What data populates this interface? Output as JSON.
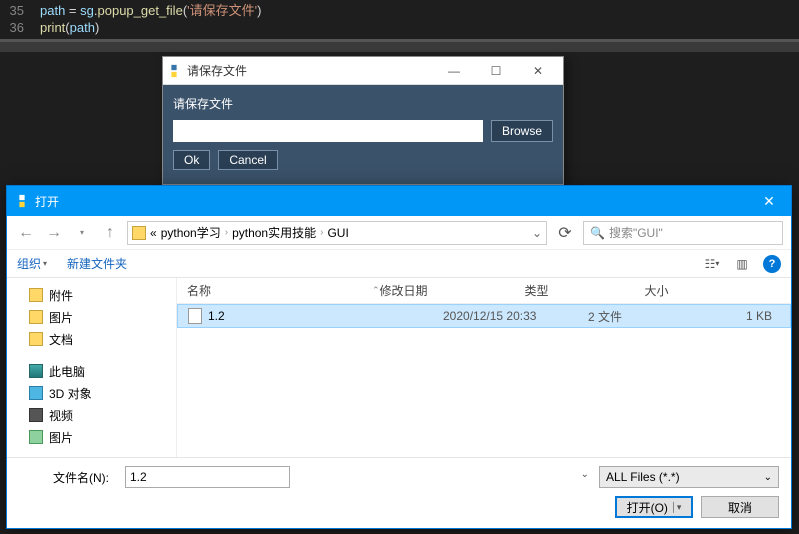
{
  "code": {
    "lines": [
      {
        "num": "35",
        "tokens": [
          {
            "t": "path",
            "c": "v"
          },
          {
            "t": " = ",
            "c": "op"
          },
          {
            "t": "sg",
            "c": "v"
          },
          {
            "t": ".",
            "c": "op"
          },
          {
            "t": "popup_get_file",
            "c": "fn"
          },
          {
            "t": "(",
            "c": "op"
          },
          {
            "t": "'请保存文件'",
            "c": "str"
          },
          {
            "t": ")",
            "c": "op"
          }
        ]
      },
      {
        "num": "36",
        "tokens": [
          {
            "t": "print",
            "c": "fn"
          },
          {
            "t": "(",
            "c": "op"
          },
          {
            "t": "path",
            "c": "v"
          },
          {
            "t": ")",
            "c": "op"
          }
        ]
      }
    ]
  },
  "popup": {
    "title": "请保存文件",
    "message": "请保存文件",
    "input_value": "",
    "browse_label": "Browse",
    "ok_label": "Ok",
    "cancel_label": "Cancel"
  },
  "filedialog": {
    "title": "打开",
    "breadcrumb": {
      "prefix": "«",
      "parts": [
        "python学习",
        "python实用技能",
        "GUI"
      ]
    },
    "search_placeholder": "搜索\"GUI\"",
    "toolbar": {
      "organize": "组织",
      "new_folder": "新建文件夹"
    },
    "tree": {
      "group1": [
        {
          "label": "附件",
          "icon": "ico-folder"
        },
        {
          "label": "图片",
          "icon": "ico-folder"
        },
        {
          "label": "文档",
          "icon": "ico-folder"
        }
      ],
      "group2": [
        {
          "label": "此电脑",
          "icon": "ico-pc"
        },
        {
          "label": "3D 对象",
          "icon": "ico-3d"
        },
        {
          "label": "视频",
          "icon": "ico-video"
        },
        {
          "label": "图片",
          "icon": "ico-pic"
        }
      ]
    },
    "columns": {
      "name": "名称",
      "date": "修改日期",
      "type": "类型",
      "size": "大小"
    },
    "rows": [
      {
        "name": "1.2",
        "date": "2020/12/15 20:33",
        "type": "2 文件",
        "size": "1 KB",
        "selected": true
      }
    ],
    "filename_label": "文件名(N):",
    "filename_value": "1.2",
    "filter_label": "ALL Files (*.*)",
    "open_label": "打开(O)",
    "cancel_label": "取消"
  },
  "watermark": ""
}
